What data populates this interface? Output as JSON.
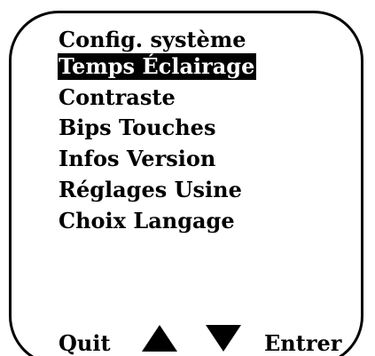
{
  "menu": {
    "title": "Config. système",
    "items": [
      {
        "label": "Temps Éclairage",
        "selected": true
      },
      {
        "label": "Contraste",
        "selected": false
      },
      {
        "label": "Bips Touches",
        "selected": false
      },
      {
        "label": "Infos Version",
        "selected": false
      },
      {
        "label": "Réglages Usine",
        "selected": false
      },
      {
        "label": "Choix Langage",
        "selected": false
      }
    ]
  },
  "softkeys": {
    "left_label": "Quit",
    "up_icon": "triangle-up-icon",
    "down_icon": "triangle-down-icon",
    "right_label": "Entrer"
  },
  "colors": {
    "foreground": "#000000",
    "background": "#ffffff",
    "selection_background": "#000000",
    "selection_text": "#ffffff"
  }
}
